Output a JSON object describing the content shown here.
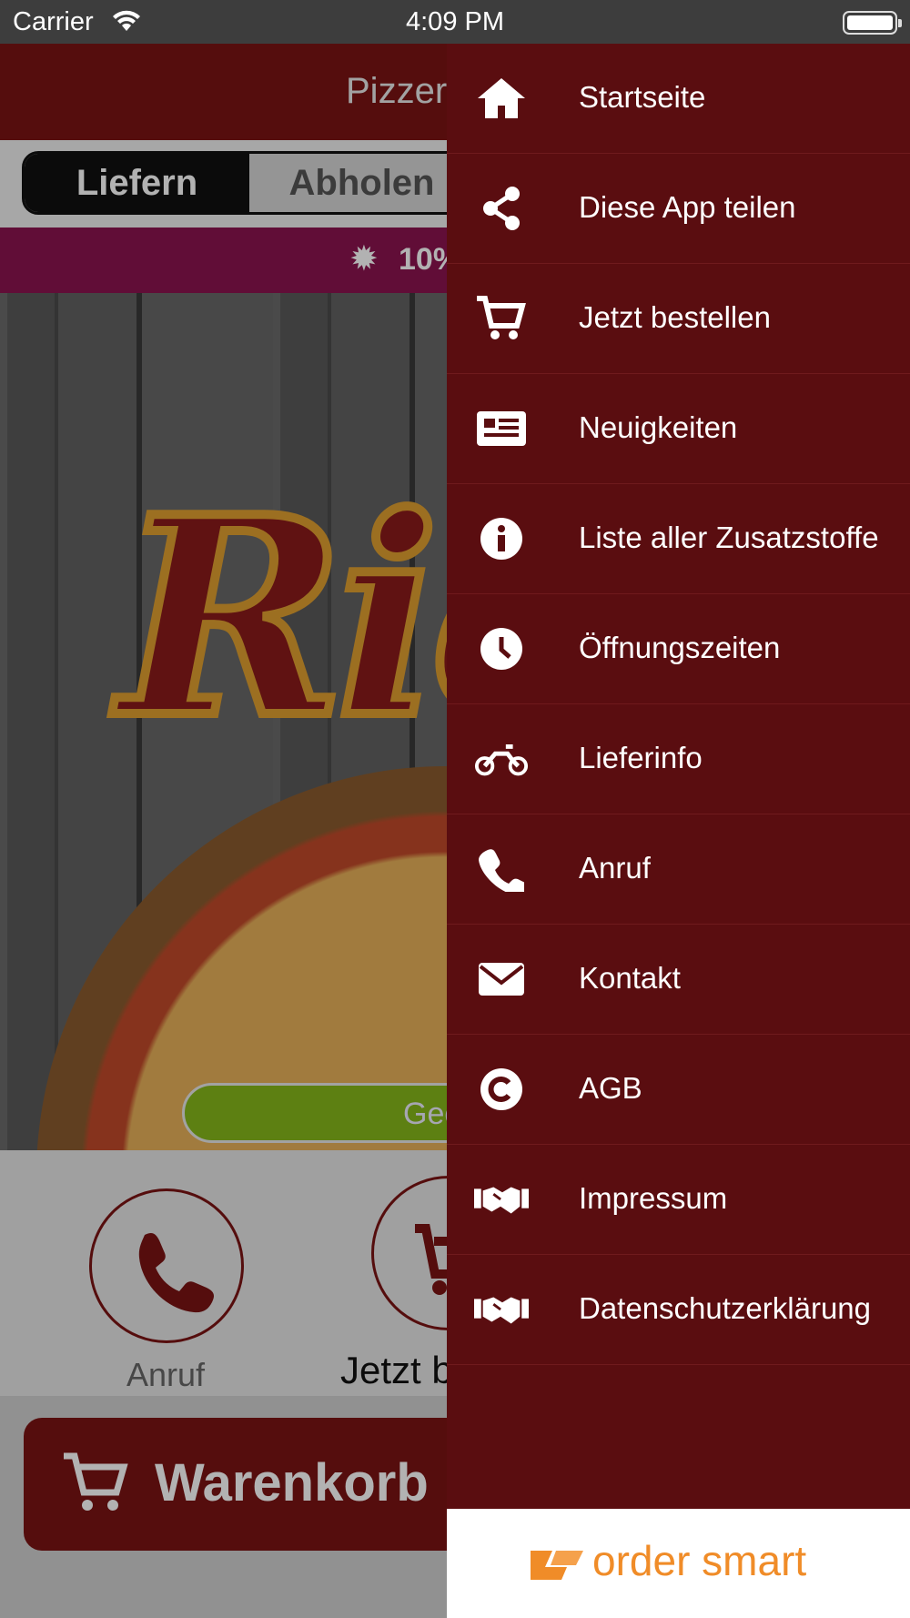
{
  "status_bar": {
    "carrier": "Carrier",
    "time": "4:09 PM"
  },
  "app": {
    "title": "Pizzeri",
    "segment": {
      "deliver": "Liefern",
      "pickup": "Abholen"
    },
    "promo": "10%",
    "hero_logo_text": "Ric",
    "open_status": "Geö",
    "quick_actions": {
      "call": "Anruf",
      "order": "Jetzt b"
    },
    "cart_label": "Warenkorb"
  },
  "drawer": {
    "items": [
      {
        "label": "Startseite",
        "icon": "home-icon"
      },
      {
        "label": "Diese App teilen",
        "icon": "share-icon"
      },
      {
        "label": "Jetzt bestellen",
        "icon": "cart-icon"
      },
      {
        "label": "Neuigkeiten",
        "icon": "newspaper-icon"
      },
      {
        "label": "Liste aller Zusatzstoffe",
        "icon": "info-icon"
      },
      {
        "label": "Öffnungszeiten",
        "icon": "clock-icon"
      },
      {
        "label": "Lieferinfo",
        "icon": "motorcycle-icon"
      },
      {
        "label": "Anruf",
        "icon": "phone-icon"
      },
      {
        "label": "Kontakt",
        "icon": "envelope-icon"
      },
      {
        "label": "AGB",
        "icon": "copyright-icon"
      },
      {
        "label": "Impressum",
        "icon": "handshake-icon"
      },
      {
        "label": "Datenschutzerklärung",
        "icon": "handshake-icon"
      }
    ],
    "footer_brand": "order smart"
  },
  "colors": {
    "drawer_bg": "#5a0d10",
    "navbar": "#7a1414",
    "promo": "#8c1450",
    "open_pill": "#86b81a",
    "brand_orange": "#f08c28"
  }
}
